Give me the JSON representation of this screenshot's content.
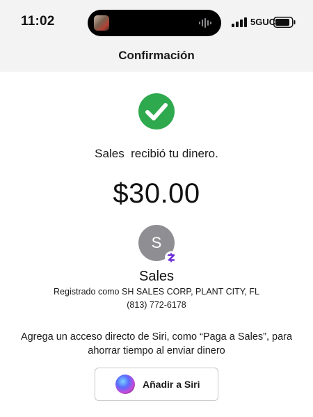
{
  "status_bar": {
    "time": "11:02",
    "network": "5GUC",
    "icons": [
      "signal-icon",
      "battery-icon",
      "audio-waveform-icon"
    ]
  },
  "header": {
    "title": "Confirmación"
  },
  "confirmation": {
    "check_icon": "checkmark-circle-icon",
    "check_color": "#2ea94e",
    "message": "Sales  recibió tu dinero.",
    "amount": "$30.00"
  },
  "recipient": {
    "avatar_initial": "S",
    "badge_icon": "cash-app-icon",
    "badge_color": "#6b2bd6",
    "name": "Sales",
    "registered_as": "Registrado como SH SALES CORP, PLANT CITY, FL",
    "phone": "(813) 772-6178"
  },
  "siri": {
    "prompt": "Agrega un acceso directo de Siri, como “Paga a Sales”, para ahorrar tiempo al enviar dinero",
    "button_label": "Añadir a Siri",
    "icon": "siri-icon"
  }
}
